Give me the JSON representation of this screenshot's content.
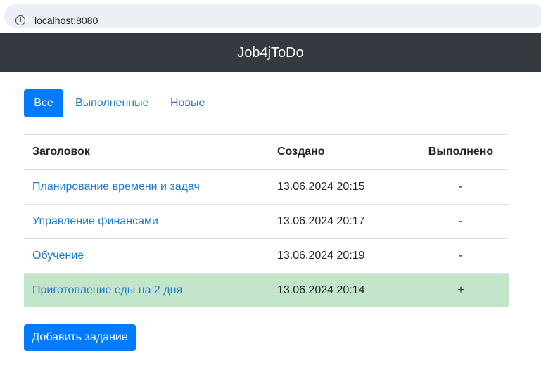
{
  "browser": {
    "url": "localhost:8080",
    "info_icon": "info-icon"
  },
  "navbar": {
    "brand": "Job4jToDo"
  },
  "filters": [
    {
      "label": "Все",
      "active": true
    },
    {
      "label": "Выполненные",
      "active": false
    },
    {
      "label": "Новые",
      "active": false
    }
  ],
  "table": {
    "headers": {
      "title": "Заголовок",
      "created": "Создано",
      "done": "Выполнено"
    },
    "rows": [
      {
        "title": "Планирование времени и задач",
        "created": "13.06.2024 20:15",
        "done": "-"
      },
      {
        "title": "Управление финансами",
        "created": "13.06.2024 20:17",
        "done": "-"
      },
      {
        "title": "Обучение",
        "created": "13.06.2024 20:19",
        "done": "-"
      },
      {
        "title": "Приготовление еды на 2 дня",
        "created": "13.06.2024 20:14",
        "done": "+"
      }
    ]
  },
  "actions": {
    "add_task": "Добавить задание"
  },
  "colors": {
    "primary": "#007bff",
    "navbar": "#343a40",
    "link": "#1d7ad0",
    "done_row": "#c3e6cb"
  }
}
